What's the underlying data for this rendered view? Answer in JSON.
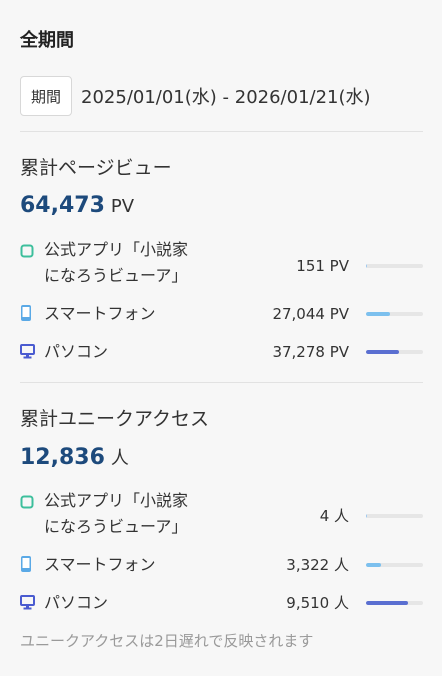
{
  "header": {
    "title": "全期間"
  },
  "period": {
    "badge": "期間",
    "range": "2025/01/01(水) - 2026/01/21(水)"
  },
  "pageviews": {
    "title": "累計ページビュー",
    "total": "64,473",
    "unit": "PV",
    "rows": [
      {
        "icon": "app-icon",
        "label_line1": "公式アプリ「小説家",
        "label_line2": "になろうビューア」",
        "value": "151 PV",
        "share": 0.002,
        "color": "#9ec9f0"
      },
      {
        "icon": "smartphone-icon",
        "label_line1": "スマートフォン",
        "value": "27,044 PV",
        "share": 0.42,
        "color": "#7cc0ee"
      },
      {
        "icon": "pc-icon",
        "label_line1": "パソコン",
        "value": "37,278 PV",
        "share": 0.58,
        "color": "#5a6fd1"
      }
    ]
  },
  "unique": {
    "title": "累計ユニークアクセス",
    "total": "12,836",
    "unit": "人",
    "rows": [
      {
        "icon": "app-icon",
        "label_line1": "公式アプリ「小説家",
        "label_line2": "になろうビューア」",
        "value": "4 人",
        "share": 0.0003,
        "color": "#9ec9f0"
      },
      {
        "icon": "smartphone-icon",
        "label_line1": "スマートフォン",
        "value": "3,322 人",
        "share": 0.26,
        "color": "#7cc0ee"
      },
      {
        "icon": "pc-icon",
        "label_line1": "パソコン",
        "value": "9,510 人",
        "share": 0.74,
        "color": "#5a6fd1"
      }
    ]
  },
  "footer": {
    "note": "ユニークアクセスは2日遅れで反映されます"
  },
  "colors": {
    "accent_number": "#1d4a7c",
    "app_icon": "#3dbf9c",
    "smartphone_icon": "#5aa9e6",
    "pc_icon": "#4a5bd0"
  }
}
